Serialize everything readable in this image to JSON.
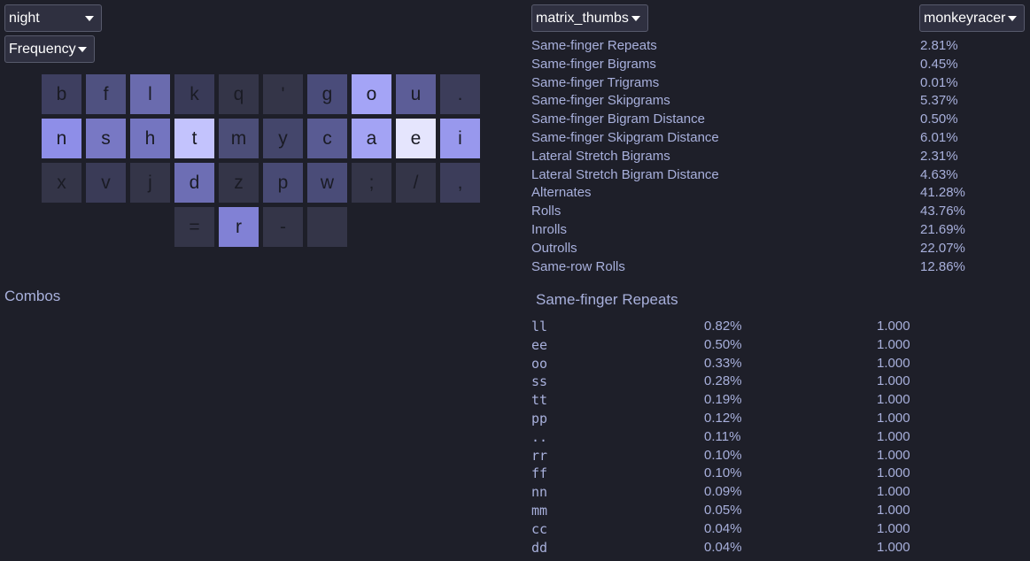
{
  "selectors": {
    "layout": "night",
    "metric": "Frequency",
    "keyboard": "matrix_thumbs",
    "corpus": "monkeyracer"
  },
  "keyboard": {
    "rows": [
      [
        {
          "key": "b",
          "color": "#3e3f60"
        },
        {
          "key": "f",
          "color": "#4f5180"
        },
        {
          "key": "l",
          "color": "#6a6bae"
        },
        {
          "key": "k",
          "color": "#393a57"
        },
        {
          "key": "q",
          "color": "#343548"
        },
        {
          "key": "'",
          "color": "#343548"
        },
        {
          "key": "g",
          "color": "#4a4c7a"
        },
        {
          "key": "o",
          "color": "#a4a4f6"
        },
        {
          "key": "u",
          "color": "#5c5d97"
        },
        {
          "key": ".",
          "color": "#3c3d5a"
        }
      ],
      [
        {
          "key": "n",
          "color": "#8e8ee8"
        },
        {
          "key": "s",
          "color": "#7878c4"
        },
        {
          "key": "h",
          "color": "#7475c0"
        },
        {
          "key": "t",
          "color": "#c3c3fd"
        },
        {
          "key": "m",
          "color": "#4c4e78"
        },
        {
          "key": "y",
          "color": "#44466b"
        },
        {
          "key": "c",
          "color": "#595b93"
        },
        {
          "key": "a",
          "color": "#a3a3f4"
        },
        {
          "key": "e",
          "color": "#e5e5fd"
        },
        {
          "key": "i",
          "color": "#9898ed"
        }
      ],
      [
        {
          "key": "x",
          "color": "#343548"
        },
        {
          "key": "v",
          "color": "#3a3b57"
        },
        {
          "key": "j",
          "color": "#343548"
        },
        {
          "key": "d",
          "color": "#6d6eb4"
        },
        {
          "key": "z",
          "color": "#343548"
        },
        {
          "key": "p",
          "color": "#484a74"
        },
        {
          "key": "w",
          "color": "#4a4c78"
        },
        {
          "key": ";",
          "color": "#343548"
        },
        {
          "key": "/",
          "color": "#343548"
        },
        {
          "key": ",",
          "color": "#3c3d5a"
        }
      ],
      [
        {
          "key": "=",
          "color": "#343548"
        },
        {
          "key": "r",
          "color": "#8181d5"
        },
        {
          "key": "-",
          "color": "#343548"
        },
        {
          "key": "",
          "color": "#343548"
        }
      ]
    ]
  },
  "combos": {
    "label": "Combos"
  },
  "stats": [
    {
      "label": "Same-finger Repeats",
      "value": "2.81%"
    },
    {
      "label": "Same-finger Bigrams",
      "value": "0.45%"
    },
    {
      "label": "Same-finger Trigrams",
      "value": "0.01%"
    },
    {
      "label": "Same-finger Skipgrams",
      "value": "5.37%"
    },
    {
      "label": "Same-finger Bigram Distance",
      "value": "0.50%"
    },
    {
      "label": "Same-finger Skipgram Distance",
      "value": "6.01%"
    },
    {
      "label": "Lateral Stretch Bigrams",
      "value": "2.31%"
    },
    {
      "label": "Lateral Stretch Bigram Distance",
      "value": "4.63%"
    },
    {
      "label": "Alternates",
      "value": "41.28%"
    },
    {
      "label": "Rolls",
      "value": "43.76%"
    },
    {
      "label": "Inrolls",
      "value": "21.69%"
    },
    {
      "label": "Outrolls",
      "value": "22.07%"
    },
    {
      "label": "Same-row Rolls",
      "value": "12.86%"
    }
  ],
  "detail": {
    "title": "Same-finger Repeats",
    "rows": [
      {
        "ngram": "ll",
        "freq": "0.82%",
        "ratio": "1.000"
      },
      {
        "ngram": "ee",
        "freq": "0.50%",
        "ratio": "1.000"
      },
      {
        "ngram": "oo",
        "freq": "0.33%",
        "ratio": "1.000"
      },
      {
        "ngram": "ss",
        "freq": "0.28%",
        "ratio": "1.000"
      },
      {
        "ngram": "tt",
        "freq": "0.19%",
        "ratio": "1.000"
      },
      {
        "ngram": "pp",
        "freq": "0.12%",
        "ratio": "1.000"
      },
      {
        "ngram": "..",
        "freq": "0.11%",
        "ratio": "1.000"
      },
      {
        "ngram": "rr",
        "freq": "0.10%",
        "ratio": "1.000"
      },
      {
        "ngram": "ff",
        "freq": "0.10%",
        "ratio": "1.000"
      },
      {
        "ngram": "nn",
        "freq": "0.09%",
        "ratio": "1.000"
      },
      {
        "ngram": "mm",
        "freq": "0.05%",
        "ratio": "1.000"
      },
      {
        "ngram": "cc",
        "freq": "0.04%",
        "ratio": "1.000"
      },
      {
        "ngram": "dd",
        "freq": "0.04%",
        "ratio": "1.000"
      }
    ]
  }
}
